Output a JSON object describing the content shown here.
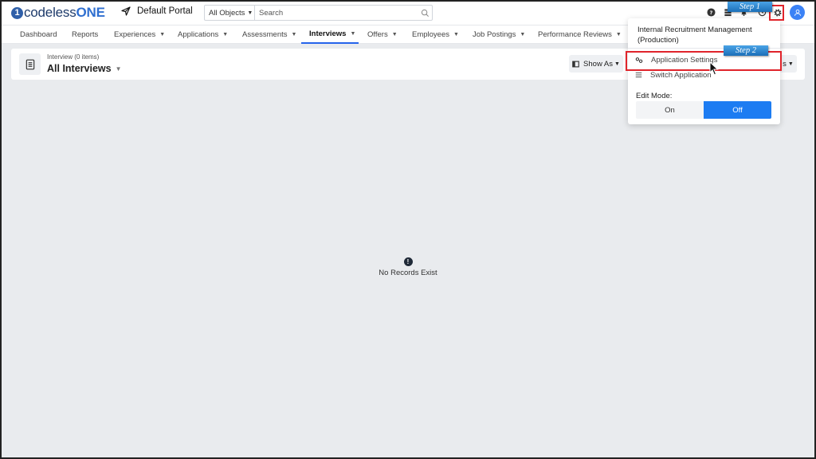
{
  "brand": {
    "logo_mark": "1",
    "logo_text_a": "codeless",
    "logo_text_b": "ONE"
  },
  "portal": {
    "label": "Default Portal",
    "icon": "paper-plane-icon"
  },
  "search": {
    "scope": "All Objects",
    "placeholder": "Search"
  },
  "top_icons": [
    "help-icon",
    "layers-icon",
    "bell-icon",
    "history-icon",
    "gear-icon",
    "user-icon"
  ],
  "nav": {
    "items": [
      {
        "label": "Dashboard",
        "caret": ""
      },
      {
        "label": "Reports",
        "caret": ""
      },
      {
        "label": "Experiences",
        "caret": "▼"
      },
      {
        "label": "Applications",
        "caret": "▼"
      },
      {
        "label": "Assessments",
        "caret": "▼"
      },
      {
        "label": "Interviews",
        "caret": "▼"
      },
      {
        "label": "Offers",
        "caret": "▼"
      },
      {
        "label": "Employees",
        "caret": "▼"
      },
      {
        "label": "Job Postings",
        "caret": "▼"
      },
      {
        "label": "Performance Reviews",
        "caret": "▼"
      }
    ],
    "active": "Interviews"
  },
  "subheader": {
    "count_label": "Interview (0 items)",
    "view_title": "All Interviews",
    "show_as": "Show As",
    "right_button": "s"
  },
  "empty_state": {
    "icon": "!",
    "text": "No Records Exist"
  },
  "dropdown": {
    "app_title": "Internal Recruitment Management (Production)",
    "items": [
      {
        "label": "Application Settings",
        "icon": "settings-cogs-icon"
      },
      {
        "label": "Switch Application",
        "icon": "menu-lines-icon"
      }
    ],
    "edit_mode_label": "Edit Mode:",
    "toggle_on": "On",
    "toggle_off": "Off",
    "edit_mode_value": "Off"
  },
  "annotations": {
    "step1": "Step 1",
    "step2": "Step 2"
  },
  "colors": {
    "accent": "#1d7cf2",
    "annotation_red": "#e0242b",
    "brand": "#2f5fa8"
  }
}
